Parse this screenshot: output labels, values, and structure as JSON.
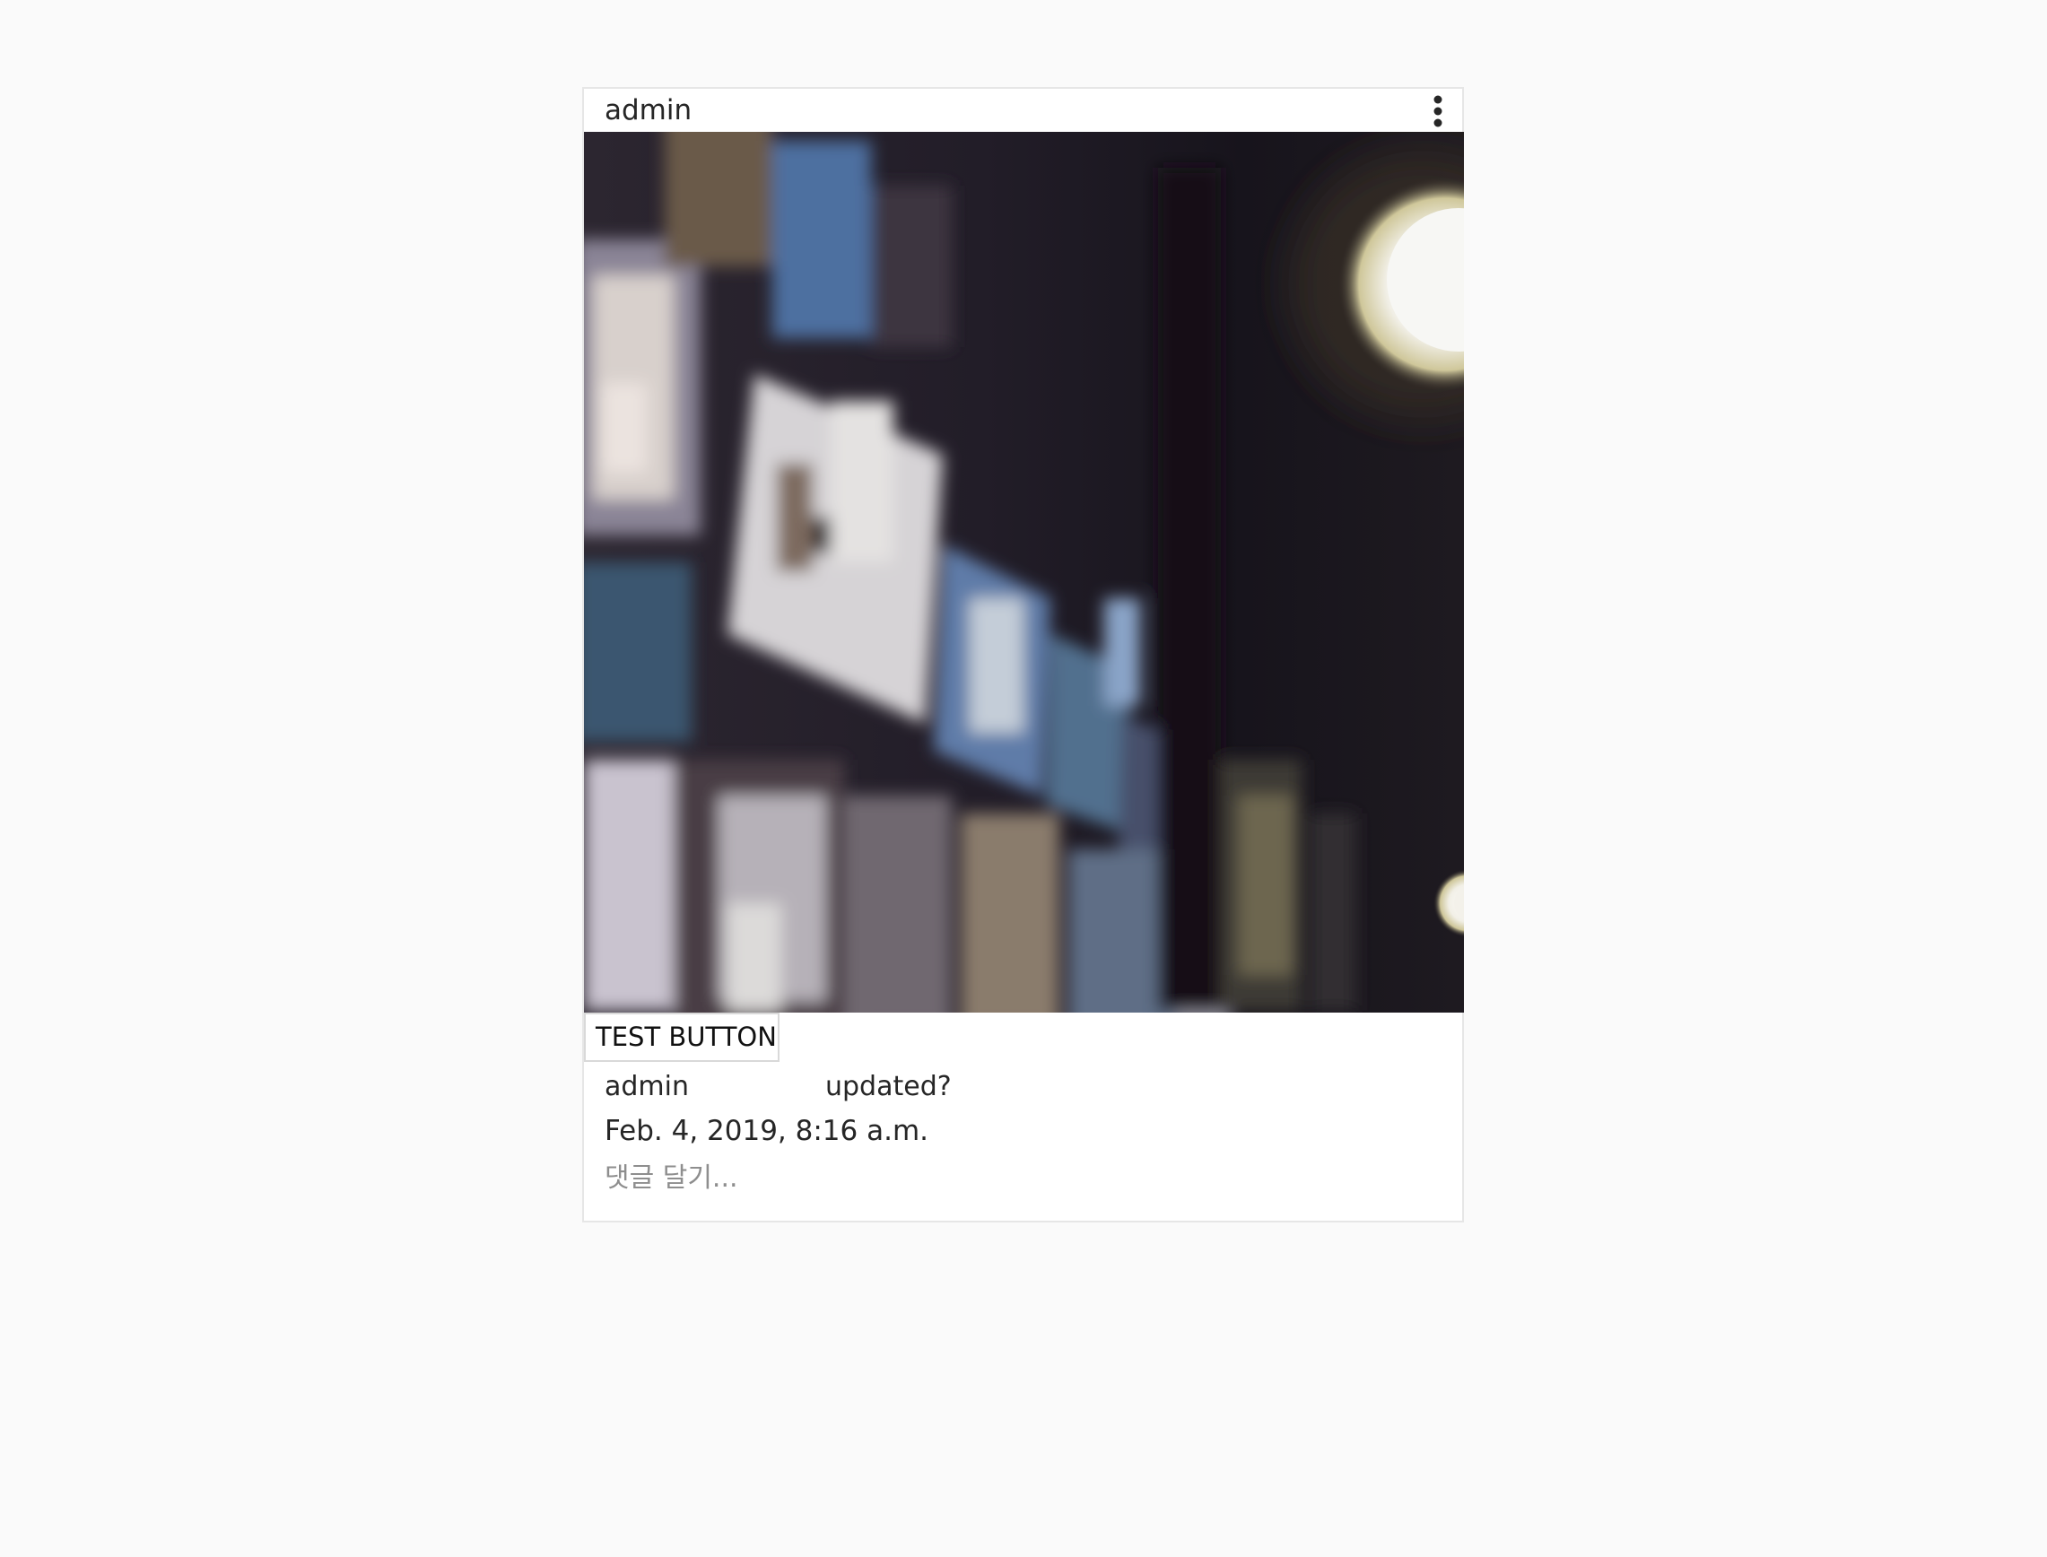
{
  "post": {
    "username": "admin",
    "menu_icon": "more-vertical-icon",
    "photo_icon": "blurred-photo",
    "test_button_label": "TEST BUTTON",
    "caption": {
      "author": "admin",
      "text": "updated?"
    },
    "timestamp": "Feb. 4, 2019, 8:16 a.m.",
    "comment_placeholder": "댓글 달기..."
  },
  "colors": {
    "page_background": "#fafafa",
    "card_background": "#ffffff",
    "card_border": "#e6e6e6",
    "text": "#262626",
    "placeholder": "#8e8e8e"
  }
}
